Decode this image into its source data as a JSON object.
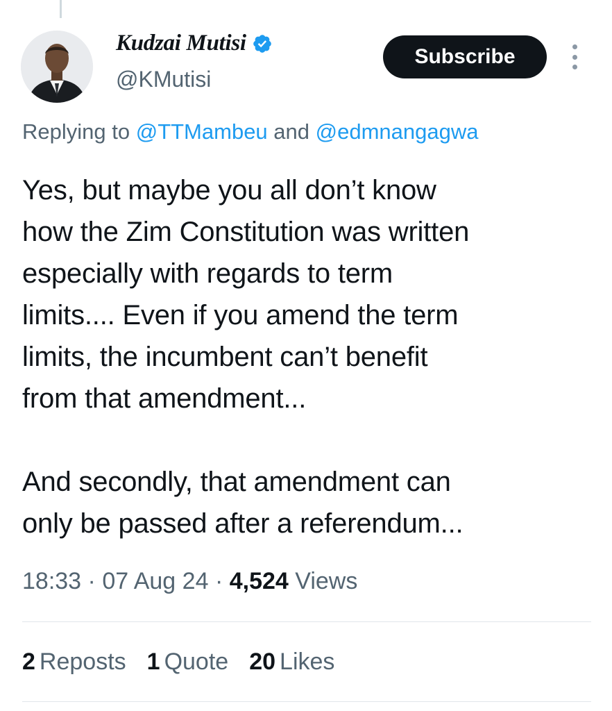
{
  "author": {
    "display_name": "Kudzai Mutisi",
    "handle": "@KMutisi",
    "verified_icon": "verified-badge-icon",
    "verified_color": "#1d9bf0"
  },
  "actions": {
    "subscribe_label": "Subscribe",
    "more_icon": "more-options-icon"
  },
  "reply": {
    "prefix": "Replying to",
    "mention_1": "@TTMambeu",
    "joiner": "and",
    "mention_2": "@edmnangagwa"
  },
  "tweet": {
    "paragraph_1": "Yes, but maybe you all don’t know\nhow the Zim Constitution was written\nespecially with regards to term\nlimits.... Even if you amend the term\nlimits, the incumbent can’t benefit\nfrom that amendment...",
    "paragraph_2": "And secondly, that amendment can\nonly be passed after a referendum..."
  },
  "meta": {
    "time": "18:33",
    "separator": "·",
    "date": "07 Aug 24",
    "views_count": "4,524",
    "views_label": "Views"
  },
  "stats": {
    "reposts_count": "2",
    "reposts_label": "Reposts",
    "quote_count": "1",
    "quote_label": "Quote",
    "likes_count": "20",
    "likes_label": "Likes"
  },
  "colors": {
    "text": "#0f1419",
    "secondary": "#536471",
    "accent": "#1d9bf0",
    "button_bg": "#0f1419"
  }
}
